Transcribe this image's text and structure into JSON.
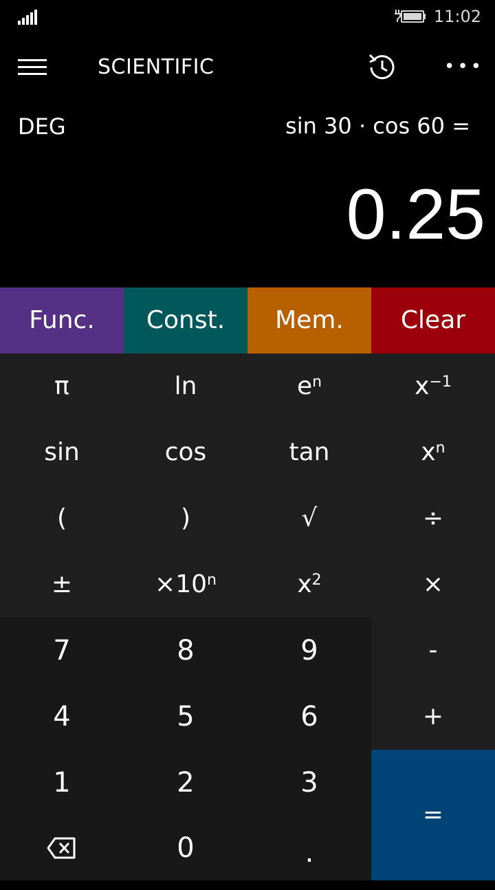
{
  "status": {
    "time": "11:02"
  },
  "app_bar": {
    "title": "SCIENTIFIC"
  },
  "display": {
    "angle_mode": "DEG",
    "expression": "sin 30 · cos 60 =",
    "result": "0.25"
  },
  "tabs": [
    {
      "label": "Func.",
      "color": "#553084"
    },
    {
      "label": "Const.",
      "color": "#00585a"
    },
    {
      "label": "Mem.",
      "color": "#b66000"
    },
    {
      "label": "Clear",
      "color": "#9b000b"
    }
  ],
  "keys": {
    "pi": "π",
    "ln": "ln",
    "e_base": "e",
    "e_sup": "n",
    "inv_base": "x",
    "inv_sup": "−1",
    "sin": "sin",
    "cos": "cos",
    "tan": "tan",
    "pow_base": "x",
    "pow_sup": "n",
    "lparen": "(",
    "rparen": ")",
    "sqrt": "√",
    "divide": "÷",
    "plusminus": "±",
    "exp_base": "×10",
    "exp_sup": "n",
    "sq_base": "x",
    "sq_sup": "2",
    "multiply": "×",
    "n7": "7",
    "n8": "8",
    "n9": "9",
    "minus": "-",
    "n4": "4",
    "n5": "5",
    "n6": "6",
    "plus": "+",
    "n1": "1",
    "n2": "2",
    "n3": "3",
    "equals": "=",
    "n0": "0",
    "decimal": "."
  },
  "icons": {
    "menu": "hamburger-icon",
    "history": "history-icon",
    "more": "more-icon",
    "backspace": "backspace-icon",
    "signal": "signal-icon",
    "battery": "battery-icon"
  }
}
